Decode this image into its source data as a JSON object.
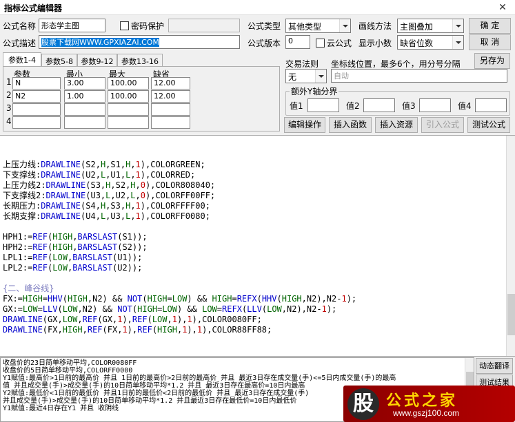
{
  "window": {
    "title": "指标公式编辑器",
    "close_glyph": "✕"
  },
  "form": {
    "name_label": "公式名称",
    "name_value": "形态学主图",
    "password_label": "密码保护",
    "desc_label": "公式描述",
    "desc_value": "股票下载网WWW.GPXIAZAI.COM",
    "type_label": "公式类型",
    "type_value": "其他类型",
    "draw_label": "画线方法",
    "draw_value": "主图叠加",
    "version_label": "公式版本",
    "version_value": "0",
    "cloud_label": "云公式",
    "decimals_label": "显示小数",
    "decimals_value": "缺省位数"
  },
  "buttons": {
    "ok": "确 定",
    "cancel": "取 消",
    "save_as": "另存为",
    "edit_op": "编辑操作",
    "insert_func": "插入函数",
    "insert_res": "插入资源",
    "import_formula": "引入公式",
    "test_formula": "测试公式",
    "translate": "动态翻译",
    "test_result": "测试结果"
  },
  "tabs": [
    "参数1-4",
    "参数5-8",
    "参数9-12",
    "参数13-16"
  ],
  "params": {
    "headers": [
      "参数",
      "最小",
      "最大",
      "缺省"
    ],
    "rows": [
      {
        "idx": "1",
        "name": "N",
        "min": "3.00",
        "max": "100.00",
        "def": "12.00"
      },
      {
        "idx": "2",
        "name": "N2",
        "min": "1.00",
        "max": "100.00",
        "def": "12.00"
      },
      {
        "idx": "3",
        "name": "",
        "min": "",
        "max": "",
        "def": ""
      },
      {
        "idx": "4",
        "name": "",
        "min": "",
        "max": "",
        "def": ""
      }
    ]
  },
  "trade": {
    "rule_label": "交易法则",
    "rule_value": "无",
    "coord_label": "坐标线位置，最多6个，用分号分隔",
    "coord_placeholder": "自动"
  },
  "extra_y": {
    "title": "额外Y轴分界",
    "v1": "值1",
    "v2": "值2",
    "v3": "值3",
    "v4": "值4"
  },
  "code_lines": [
    {
      "segs": [
        [
          "t",
          "上压力线:"
        ],
        [
          "f",
          "DRAWLINE"
        ],
        [
          "t",
          "(S2,"
        ],
        [
          "k",
          "H"
        ],
        [
          "t",
          ",S1,"
        ],
        [
          "k",
          "H"
        ],
        [
          "t",
          ","
        ],
        [
          "n",
          "1"
        ],
        [
          "t",
          "),COLORGREEN;"
        ]
      ]
    },
    {
      "segs": [
        [
          "t",
          "下支撑线:"
        ],
        [
          "f",
          "DRAWLINE"
        ],
        [
          "t",
          "(U2,"
        ],
        [
          "k",
          "L"
        ],
        [
          "t",
          ",U1,"
        ],
        [
          "k",
          "L"
        ],
        [
          "t",
          ","
        ],
        [
          "n",
          "1"
        ],
        [
          "t",
          "),COLORRED;"
        ]
      ]
    },
    {
      "segs": [
        [
          "t",
          "上压力线2:"
        ],
        [
          "f",
          "DRAWLINE"
        ],
        [
          "t",
          "(S3,"
        ],
        [
          "k",
          "H"
        ],
        [
          "t",
          ",S2,"
        ],
        [
          "k",
          "H"
        ],
        [
          "t",
          ","
        ],
        [
          "n",
          "0"
        ],
        [
          "t",
          "),COLOR808040;"
        ]
      ]
    },
    {
      "segs": [
        [
          "t",
          "下支撑线2:"
        ],
        [
          "f",
          "DRAWLINE"
        ],
        [
          "t",
          "(U3,"
        ],
        [
          "k",
          "L"
        ],
        [
          "t",
          ",U2,"
        ],
        [
          "k",
          "L"
        ],
        [
          "t",
          ","
        ],
        [
          "n",
          "0"
        ],
        [
          "t",
          "),COLORFF00FF;"
        ]
      ]
    },
    {
      "segs": [
        [
          "t",
          "长期压力:"
        ],
        [
          "f",
          "DRAWLINE"
        ],
        [
          "t",
          "(S4,"
        ],
        [
          "k",
          "H"
        ],
        [
          "t",
          ",S3,"
        ],
        [
          "k",
          "H"
        ],
        [
          "t",
          ","
        ],
        [
          "n",
          "1"
        ],
        [
          "t",
          "),COLORFFFF00;"
        ]
      ]
    },
    {
      "segs": [
        [
          "t",
          "长期支撑:"
        ],
        [
          "f",
          "DRAWLINE"
        ],
        [
          "t",
          "(U4,"
        ],
        [
          "k",
          "L"
        ],
        [
          "t",
          ",U3,"
        ],
        [
          "k",
          "L"
        ],
        [
          "t",
          ","
        ],
        [
          "n",
          "1"
        ],
        [
          "t",
          "),COLORFF0080;"
        ]
      ]
    },
    {
      "segs": [
        [
          "t",
          ""
        ]
      ]
    },
    {
      "segs": [
        [
          "t",
          "HPH1:="
        ],
        [
          "f",
          "REF"
        ],
        [
          "t",
          "("
        ],
        [
          "k",
          "HIGH"
        ],
        [
          "t",
          ","
        ],
        [
          "f",
          "BARSLAST"
        ],
        [
          "t",
          "(S1));"
        ]
      ]
    },
    {
      "segs": [
        [
          "t",
          "HPH2:="
        ],
        [
          "f",
          "REF"
        ],
        [
          "t",
          "("
        ],
        [
          "k",
          "HIGH"
        ],
        [
          "t",
          ","
        ],
        [
          "f",
          "BARSLAST"
        ],
        [
          "t",
          "(S2));"
        ]
      ]
    },
    {
      "segs": [
        [
          "t",
          "LPL1:="
        ],
        [
          "f",
          "REF"
        ],
        [
          "t",
          "("
        ],
        [
          "k",
          "LOW"
        ],
        [
          "t",
          ","
        ],
        [
          "f",
          "BARSLAST"
        ],
        [
          "t",
          "(U1));"
        ]
      ]
    },
    {
      "segs": [
        [
          "t",
          "LPL2:="
        ],
        [
          "f",
          "REF"
        ],
        [
          "t",
          "("
        ],
        [
          "k",
          "LOW"
        ],
        [
          "t",
          ","
        ],
        [
          "f",
          "BARSLAST"
        ],
        [
          "t",
          "(U2));"
        ]
      ]
    },
    {
      "segs": [
        [
          "t",
          ""
        ]
      ]
    },
    {
      "segs": [
        [
          "c",
          "{二、峰谷线}"
        ]
      ]
    },
    {
      "segs": [
        [
          "t",
          "FX:="
        ],
        [
          "k",
          "HIGH"
        ],
        [
          "t",
          "="
        ],
        [
          "f",
          "HHV"
        ],
        [
          "t",
          "("
        ],
        [
          "k",
          "HIGH"
        ],
        [
          "t",
          ",N2) && "
        ],
        [
          "f",
          "NOT"
        ],
        [
          "t",
          "("
        ],
        [
          "k",
          "HIGH"
        ],
        [
          "t",
          "="
        ],
        [
          "k",
          "LOW"
        ],
        [
          "t",
          ") && "
        ],
        [
          "k",
          "HIGH"
        ],
        [
          "t",
          "="
        ],
        [
          "f",
          "REFX"
        ],
        [
          "t",
          "("
        ],
        [
          "f",
          "HHV"
        ],
        [
          "t",
          "("
        ],
        [
          "k",
          "HIGH"
        ],
        [
          "t",
          ",N2),N2-"
        ],
        [
          "n",
          "1"
        ],
        [
          "t",
          ");"
        ]
      ]
    },
    {
      "segs": [
        [
          "t",
          "GX:="
        ],
        [
          "k",
          "LOW"
        ],
        [
          "t",
          "="
        ],
        [
          "f",
          "LLV"
        ],
        [
          "t",
          "("
        ],
        [
          "k",
          "LOW"
        ],
        [
          "t",
          ",N2) && "
        ],
        [
          "f",
          "NOT"
        ],
        [
          "t",
          "("
        ],
        [
          "k",
          "HIGH"
        ],
        [
          "t",
          "="
        ],
        [
          "k",
          "LOW"
        ],
        [
          "t",
          ") && "
        ],
        [
          "k",
          "LOW"
        ],
        [
          "t",
          "="
        ],
        [
          "f",
          "REFX"
        ],
        [
          "t",
          "("
        ],
        [
          "f",
          "LLV"
        ],
        [
          "t",
          "("
        ],
        [
          "k",
          "LOW"
        ],
        [
          "t",
          ",N2),N2-"
        ],
        [
          "n",
          "1"
        ],
        [
          "t",
          ");"
        ]
      ]
    },
    {
      "segs": [
        [
          "f",
          "DRAWLINE"
        ],
        [
          "t",
          "(GX,"
        ],
        [
          "k",
          "LOW"
        ],
        [
          "t",
          ","
        ],
        [
          "f",
          "REF"
        ],
        [
          "t",
          "(GX,"
        ],
        [
          "n",
          "1"
        ],
        [
          "t",
          "),"
        ],
        [
          "f",
          "REF"
        ],
        [
          "t",
          "("
        ],
        [
          "k",
          "LOW"
        ],
        [
          "t",
          ","
        ],
        [
          "n",
          "1"
        ],
        [
          "t",
          "),"
        ],
        [
          "n",
          "1"
        ],
        [
          "t",
          "),COLOR0080FF;"
        ]
      ]
    },
    {
      "segs": [
        [
          "f",
          "DRAWLINE"
        ],
        [
          "t",
          "(FX,"
        ],
        [
          "k",
          "HIGH"
        ],
        [
          "t",
          ","
        ],
        [
          "f",
          "REF"
        ],
        [
          "t",
          "(FX,"
        ],
        [
          "n",
          "1"
        ],
        [
          "t",
          "),"
        ],
        [
          "f",
          "REF"
        ],
        [
          "t",
          "("
        ],
        [
          "k",
          "HIGH"
        ],
        [
          "t",
          ","
        ],
        [
          "n",
          "1"
        ],
        [
          "t",
          "),"
        ],
        [
          "n",
          "1"
        ],
        [
          "t",
          "),COLOR88FF88;"
        ]
      ]
    }
  ],
  "bottom_lines": [
    "收盘价的23日简单移动平均,COLOR0080FF",
    "收盘价的5日简单移动平均,COLORFF0000",
    "Y1赋值:最高价>1日前的最高价 并且 1日前的最高价>2日前的最高价 并且 最近3日存在成交量(手)<=5日内成交量(手)的最高",
    "值 并且成交量(手)>成交量(手)的10日简单移动平均*1.2 并且 最近3日存在最高价=10日内最高",
    "Y2赋值:最低价<1日前的最低价 并且1日前的最低价<2日前的最低价 并且 最近3日存在成交量(手)",
    "并且成交量(手)>成交量(手)的10日简单移动平均*1.2 并且最近3日存在最低价=10日内最低价",
    "Y1赋值:最近4日存在Y1 并且 收阴线"
  ],
  "watermark": {
    "logo_char": "股",
    "brand": "公式之家",
    "url": "www.gszj100.com"
  }
}
